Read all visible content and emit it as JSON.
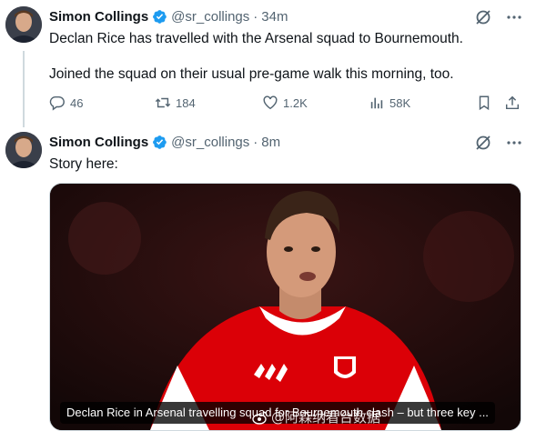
{
  "colors": {
    "verified": "#1d9bf0",
    "muted": "#536471",
    "text": "#0f1419",
    "shirt_red": "#db0007"
  },
  "tweets": [
    {
      "author": {
        "name": "Simon Collings",
        "handle": "@sr_collings"
      },
      "time": "34m",
      "paragraphs": [
        "Declan Rice has travelled with the Arsenal squad to Bournemouth.",
        "Joined the squad on their usual pre-game walk this morning, too."
      ],
      "actions": {
        "replies": "46",
        "reposts": "184",
        "likes": "1.2K",
        "views": "58K"
      },
      "icons": [
        "grok-icon",
        "more-icon",
        "reply-icon",
        "repost-icon",
        "like-icon",
        "views-icon",
        "bookmark-icon",
        "share-icon"
      ]
    },
    {
      "author": {
        "name": "Simon Collings",
        "handle": "@sr_collings"
      },
      "time": "8m",
      "paragraphs": [
        "Story here:"
      ],
      "card": {
        "caption": "Declan Rice in Arsenal travelling squad for Bournemouth clash – but three key ...",
        "watermark": "@阿森纳看台数据",
        "image_alt": "Declan Rice in Arsenal shirt"
      },
      "icons": [
        "grok-icon",
        "more-icon"
      ]
    }
  ],
  "separator": "·"
}
